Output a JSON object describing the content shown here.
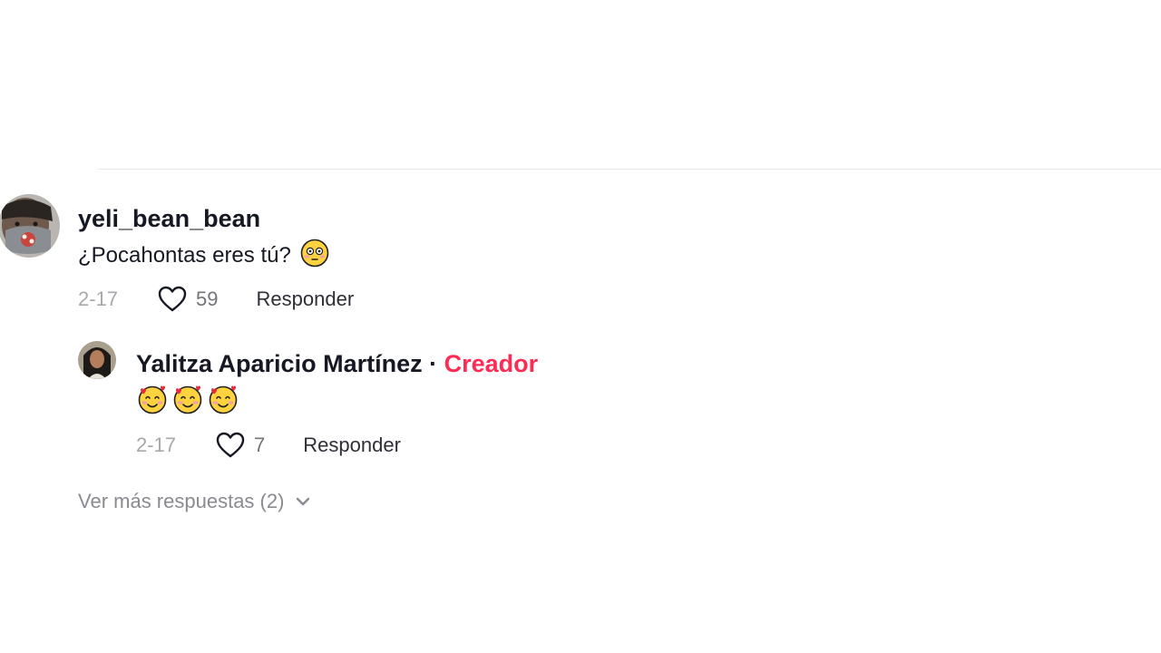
{
  "comments": [
    {
      "username": "yeli_bean_bean",
      "text": "¿Pocahontas eres tú?",
      "emoji_icon": "flushed-face-emoji",
      "date": "2-17",
      "likes": "59",
      "reply_label": "Responder"
    }
  ],
  "reply": {
    "username": "Yalitza Aparicio Martínez",
    "separator": "·",
    "creator_label": "Creador",
    "emoji_icons": [
      "smiling-face-with-hearts-emoji",
      "smiling-face-with-hearts-emoji",
      "smiling-face-with-hearts-emoji"
    ],
    "date": "2-17",
    "likes": "7",
    "reply_label": "Responder"
  },
  "more_replies": {
    "label": "Ver más respuestas (2)",
    "icon": "chevron-down-icon"
  },
  "colors": {
    "creator": "#fe2c55",
    "text": "#161823",
    "muted": "#a7a8ac"
  }
}
